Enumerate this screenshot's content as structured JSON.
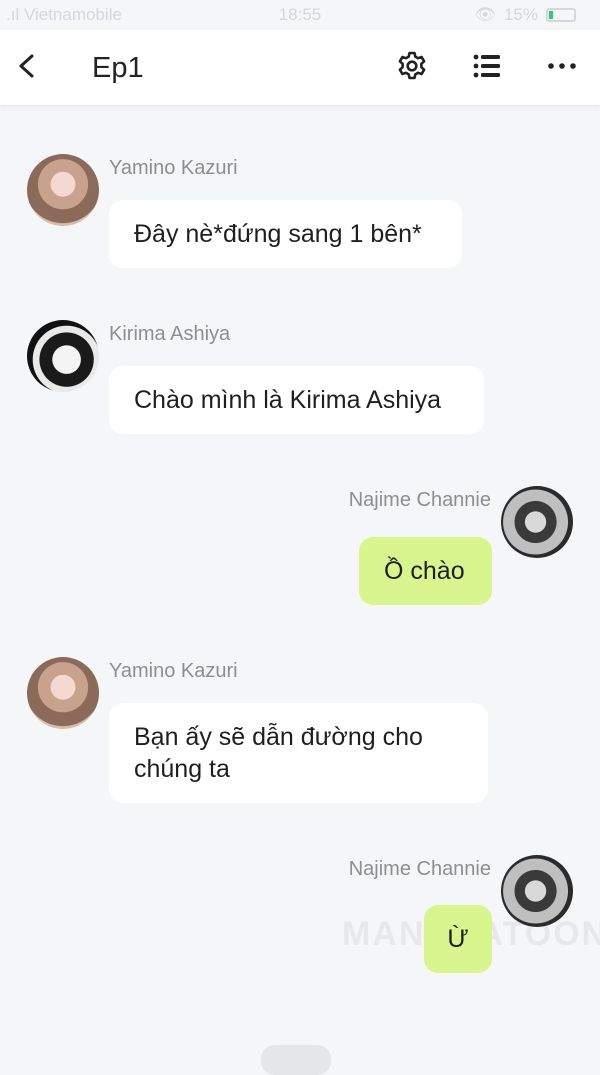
{
  "status": {
    "carrier": ".ıl Vietnamobile",
    "time": "18:55",
    "battery": "15%"
  },
  "header": {
    "title": "Ep1"
  },
  "messages": [
    {
      "sender": "Yamino Kazuri",
      "text": "Đây nè*đứng sang 1 bên*"
    },
    {
      "sender": "Kirima Ashiya",
      "text": "Chào mình là Kirima Ashiya"
    },
    {
      "sender": "Najime Channie",
      "text": "Ồ chào"
    },
    {
      "sender": "Yamino Kazuri",
      "text": "Bạn ấy sẽ dẫn đường cho chúng ta"
    },
    {
      "sender": "Najime Channie",
      "text": "Ừ"
    }
  ],
  "watermark": "MANHUATOON"
}
